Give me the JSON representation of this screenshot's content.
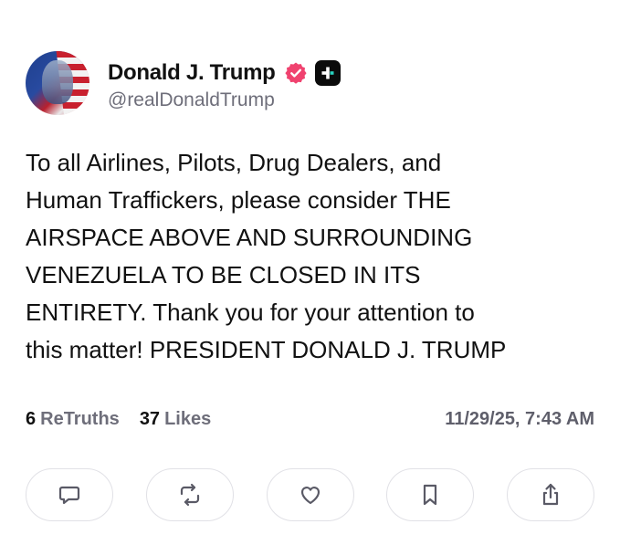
{
  "author": {
    "display_name": "Donald J. Trump",
    "handle": "@realDonaldTrump",
    "verified_color": "#f0426f",
    "avatar_icon": "american-flag-portrait"
  },
  "post": {
    "text": "To all Airlines, Pilots, Drug Dealers, and\nHuman Traffickers, please consider THE\nAIRSPACE ABOVE AND SURROUNDING\nVENEZUELA TO BE CLOSED IN ITS\nENTIRETY. Thank you for your attention to\nthis matter! PRESIDENT DONALD J. TRUMP"
  },
  "stats": {
    "retruths_count": "6",
    "retruths_label": "ReTruths",
    "likes_count": "37",
    "likes_label": "Likes",
    "timestamp": "11/29/25, 7:43 AM"
  },
  "actions": [
    {
      "icon": "comment-icon"
    },
    {
      "icon": "retruth-icon"
    },
    {
      "icon": "heart-icon"
    },
    {
      "icon": "bookmark-icon"
    },
    {
      "icon": "share-icon"
    }
  ]
}
